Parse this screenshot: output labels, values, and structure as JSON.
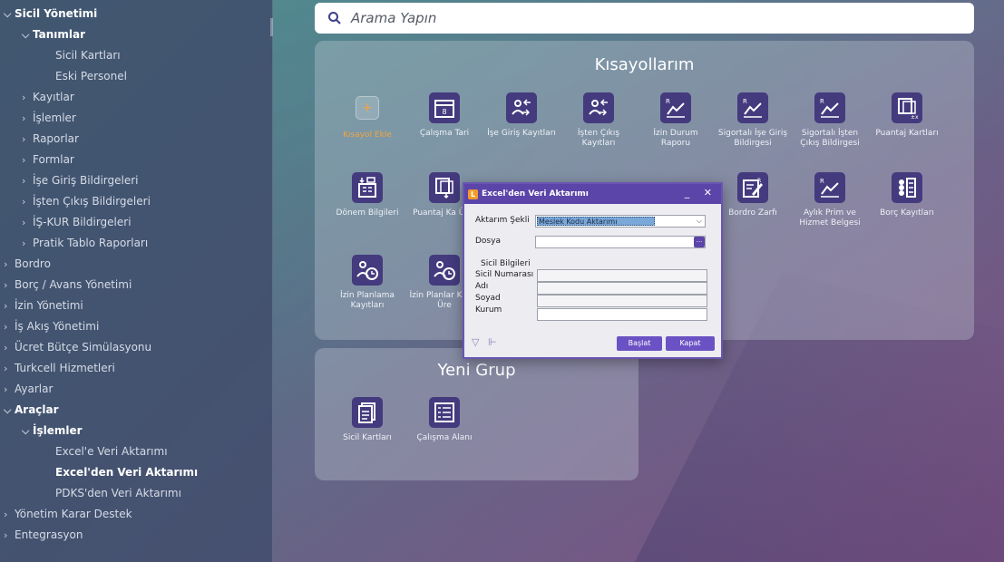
{
  "sidebar": {
    "items": [
      {
        "label": "Sicil Yönetimi",
        "chevron": "⌵"
      },
      {
        "label": "Tanımlar",
        "chevron": "⌵"
      },
      {
        "label": "Sicil Kartları",
        "chevron": ""
      },
      {
        "label": "Eski Personel",
        "chevron": ""
      },
      {
        "label": "Kayıtlar",
        "chevron": "›"
      },
      {
        "label": "İşlemler",
        "chevron": "›"
      },
      {
        "label": "Raporlar",
        "chevron": "›"
      },
      {
        "label": "Formlar",
        "chevron": "›"
      },
      {
        "label": "İşe Giriş Bildirgeleri",
        "chevron": "›"
      },
      {
        "label": "İşten Çıkış Bildirgeleri",
        "chevron": "›"
      },
      {
        "label": "İŞ-KUR Bildirgeleri",
        "chevron": "›"
      },
      {
        "label": "Pratik Tablo Raporları",
        "chevron": "›"
      },
      {
        "label": "Bordro",
        "chevron": "›"
      },
      {
        "label": "Borç / Avans Yönetimi",
        "chevron": "›"
      },
      {
        "label": "İzin Yönetimi",
        "chevron": "›"
      },
      {
        "label": "İş Akış Yönetimi",
        "chevron": "›"
      },
      {
        "label": "Ücret Bütçe Simülasyonu",
        "chevron": "›"
      },
      {
        "label": "Turkcell Hizmetleri",
        "chevron": "›"
      },
      {
        "label": "Ayarlar",
        "chevron": "›"
      },
      {
        "label": "Araçlar",
        "chevron": "⌵"
      },
      {
        "label": "İşlemler",
        "chevron": "⌵"
      },
      {
        "label": "Excel'e Veri Aktarımı",
        "chevron": ""
      },
      {
        "label": "Excel'den Veri Aktarımı",
        "chevron": ""
      },
      {
        "label": "PDKS'den Veri Aktarımı",
        "chevron": ""
      },
      {
        "label": "Yönetim Karar Destek",
        "chevron": "›"
      },
      {
        "label": "Entegrasyon",
        "chevron": "›"
      }
    ]
  },
  "search": {
    "placeholder": "Arama Yapın"
  },
  "shortcuts": {
    "title": "Kısayollarım",
    "tiles": [
      {
        "label": "Kısayol Ekle",
        "icon": "plus-icon"
      },
      {
        "label": "Çalışma Tari",
        "icon": "calendar-icon"
      },
      {
        "label": "İşe Giriş Kayıtları",
        "icon": "person-in-icon"
      },
      {
        "label": "İşten Çıkış Kayıtları",
        "icon": "person-out-icon"
      },
      {
        "label": "İzin Durum Raporu",
        "icon": "report-chart-icon"
      },
      {
        "label": "Sigortalı İşe Giriş Bildirgesi",
        "icon": "report-chart-icon"
      },
      {
        "label": "Sigortalı İşten Çıkış Bildirgesi",
        "icon": "report-chart-icon"
      },
      {
        "label": "Puantaj Kartları",
        "icon": "timesheet-icon"
      },
      {
        "label": "Dönem Bilgileri",
        "icon": "period-icon"
      },
      {
        "label": "Puantaj Ka Üret",
        "icon": "timesheet-icon"
      },
      {
        "label": "Bordro Zarfı",
        "icon": "envelope-edit-icon"
      },
      {
        "label": "Aylık Prim ve Hizmet Belgesi",
        "icon": "report-chart-icon"
      },
      {
        "label": "Borç Kayıtları",
        "icon": "list-check-icon"
      },
      {
        "label": "İzin Planlama Kayıtları",
        "icon": "person-clock-icon"
      },
      {
        "label": "İzin Planlar Kaydı Üre",
        "icon": "person-clock-icon"
      }
    ]
  },
  "new_group": {
    "title": "Yeni Grup",
    "tiles": [
      {
        "label": "Sicil Kartları",
        "icon": "cards-icon"
      },
      {
        "label": "Çalışma Alanı",
        "icon": "list-icon"
      }
    ]
  },
  "dialog": {
    "title": "Excel'den Veri Aktarımı",
    "transfer_type_label": "Aktarım Şekli",
    "transfer_type_value": "Meslek Kodu Aktarımı",
    "file_label": "Dosya",
    "file_value": "",
    "section_label": "Sicil Bilgileri",
    "sicil_no_label": "Sicil Numarası",
    "name_label": "Adı",
    "surname_label": "Soyad",
    "company_label": "Kurum",
    "start_button": "Başlat",
    "close_button": "Kapat",
    "window_controls": "_ ✕"
  }
}
